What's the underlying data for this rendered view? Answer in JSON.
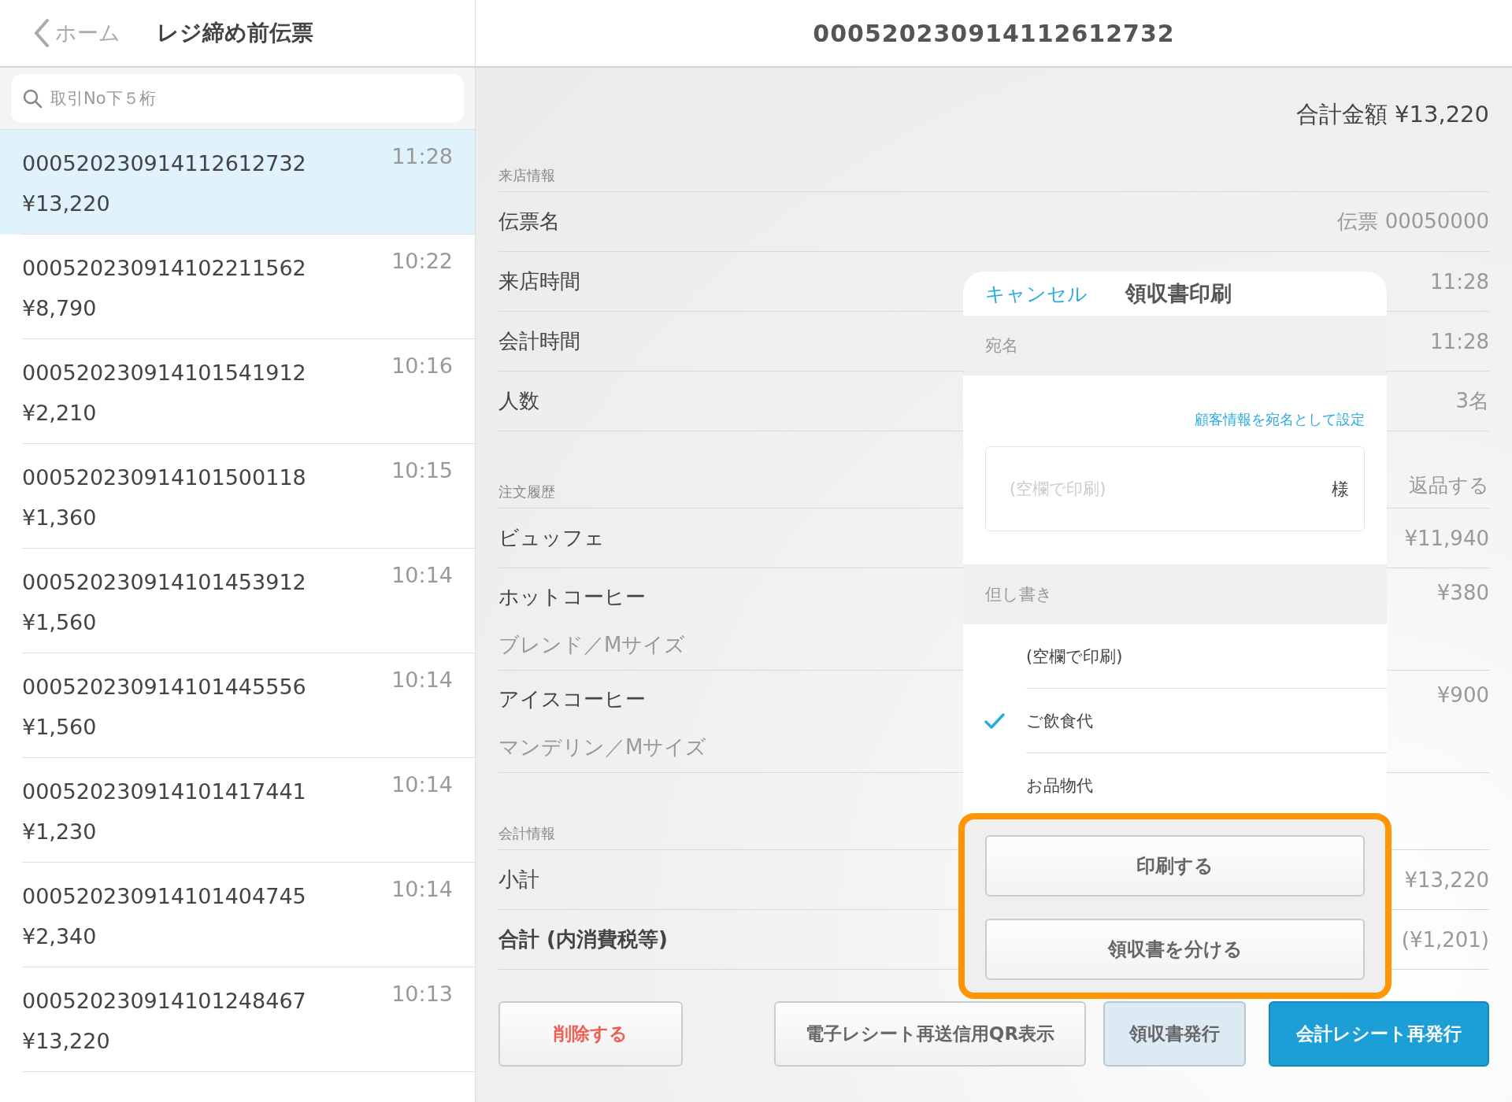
{
  "header": {
    "back_label": "ホーム",
    "title": "レジ締め前伝票"
  },
  "search": {
    "placeholder": "取引No下５桁"
  },
  "transactions": [
    {
      "number": "000520230914112612732",
      "amount": "¥13,220",
      "time": "11:28",
      "selected": true
    },
    {
      "number": "000520230914102211562",
      "amount": "¥8,790",
      "time": "10:22",
      "selected": false
    },
    {
      "number": "000520230914101541912",
      "amount": "¥2,210",
      "time": "10:16",
      "selected": false
    },
    {
      "number": "000520230914101500118",
      "amount": "¥1,360",
      "time": "10:15",
      "selected": false
    },
    {
      "number": "000520230914101453912",
      "amount": "¥1,560",
      "time": "10:14",
      "selected": false
    },
    {
      "number": "000520230914101445556",
      "amount": "¥1,560",
      "time": "10:14",
      "selected": false
    },
    {
      "number": "000520230914101417441",
      "amount": "¥1,230",
      "time": "10:14",
      "selected": false
    },
    {
      "number": "000520230914101404745",
      "amount": "¥2,340",
      "time": "10:14",
      "selected": false
    },
    {
      "number": "000520230914101248467",
      "amount": "¥13,220",
      "time": "10:13",
      "selected": false
    }
  ],
  "detail": {
    "title": "000520230914112612732",
    "total": "合計金額 ¥13,220",
    "sections": [
      {
        "heading": "来店情報",
        "rows": [
          {
            "label": "伝票名",
            "value": "伝票 00050000",
            "bold": false
          },
          {
            "label": "来店時間",
            "value": "11:28",
            "bold": false
          },
          {
            "label": "会計時間",
            "value": "11:28",
            "bold": false
          },
          {
            "label": "人数",
            "value": "3名",
            "bold": false
          }
        ]
      },
      {
        "heading": "注文履歴",
        "action": "返品する",
        "rows": [
          {
            "label": "ビュッフェ",
            "value": "¥11,940",
            "bold": false
          },
          {
            "label": "ホットコーヒー",
            "sub": "ブレンド／Mサイズ",
            "value": "¥380",
            "bold": false
          },
          {
            "label": "アイスコーヒー",
            "sub": "マンデリン／Mサイズ",
            "value": "¥900",
            "bold": false
          }
        ]
      },
      {
        "heading": "会計情報",
        "rows": [
          {
            "label": "小計",
            "value": "¥13,220",
            "bold": false
          },
          {
            "label": "合計 (内消費税等)",
            "value": "(¥1,201)",
            "bold": true
          }
        ]
      }
    ],
    "buttons": [
      {
        "label": "削除する",
        "kind": "danger"
      },
      {
        "label": "電子レシート再送信用QR表示",
        "kind": "default"
      },
      {
        "label": "領収書発行",
        "kind": "secondary"
      },
      {
        "label": "会計レシート再発行",
        "kind": "primary"
      }
    ]
  },
  "receipt_dialog": {
    "cancel": "キャンセル",
    "title": "領収書印刷",
    "addressee_heading": "宛名",
    "customer_link": "顧客情報を宛名として設定",
    "name_field": {
      "placeholder": "(空欄で印刷)",
      "suffix": "様"
    },
    "note_heading": "但し書き",
    "note_options": [
      {
        "label": "(空欄で印刷)",
        "selected": false
      },
      {
        "label": "ご飲食代",
        "selected": true
      },
      {
        "label": "お品物代",
        "selected": false
      }
    ],
    "buttons": [
      "印刷する",
      "領収書を分ける"
    ],
    "highlighted": true
  }
}
